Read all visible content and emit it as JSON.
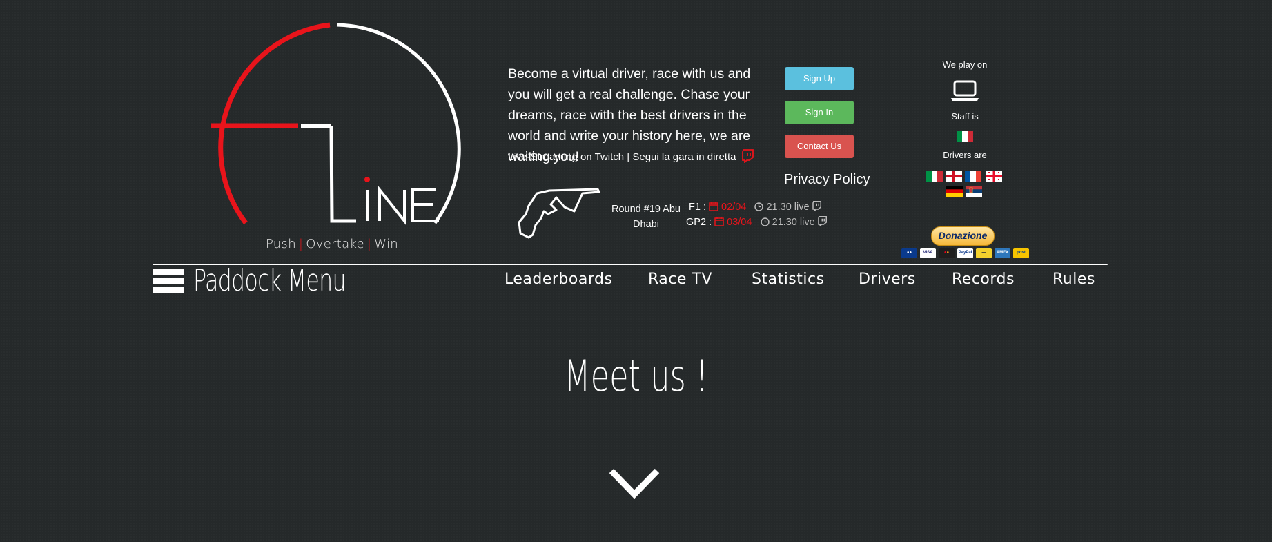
{
  "logo": {
    "tagline": [
      "Push",
      "Overtake",
      "Win"
    ],
    "tagline_separator": "|",
    "accent": "#e8141b"
  },
  "intro": {
    "text": "Become a virtual driver, race with us and you will get a real challenge. Chase your dreams, race with the best drivers in the world and write your history here, we are waiting you!",
    "stream": "Live-Streaming on Twitch | Segui la gara in diretta",
    "stream_icon": "twitch-icon"
  },
  "buttons": {
    "signup": {
      "label": "Sign Up",
      "color": "#5bc0de"
    },
    "signin": {
      "label": "Sign In",
      "color": "#5cb85c"
    },
    "contact": {
      "label": "Contact Us",
      "color": "#d9534f"
    }
  },
  "privacy": "Privacy Policy",
  "round": {
    "label": "Round #19 Abu Dhabi",
    "races": [
      {
        "series": "F1 :",
        "date": "02/04",
        "time": "21.30 live"
      },
      {
        "series": "GP2 :",
        "date": "03/04",
        "time": "21.30 live"
      }
    ]
  },
  "right": {
    "we_play_on": "We play on",
    "platform_icon": "laptop-icon",
    "staff_is": "Staff is",
    "staff_flag": "italy",
    "drivers_are": "Drivers are",
    "driver_flags": [
      "italy",
      "england",
      "france",
      "georgia",
      "germany",
      "serbia"
    ],
    "donate": "Donazione",
    "payment_cards": [
      "maestro",
      "visa",
      "mastercard",
      "paypal",
      "card",
      "amex",
      "postepay"
    ]
  },
  "nav": {
    "menu_label": "Paddock Menu",
    "items": [
      "Leaderboards",
      "Race TV",
      "Statistics",
      "Drivers",
      "Records",
      "Rules"
    ]
  },
  "hero": {
    "title": "Meet us !",
    "scroll_icon": "chevron-down-icon"
  }
}
